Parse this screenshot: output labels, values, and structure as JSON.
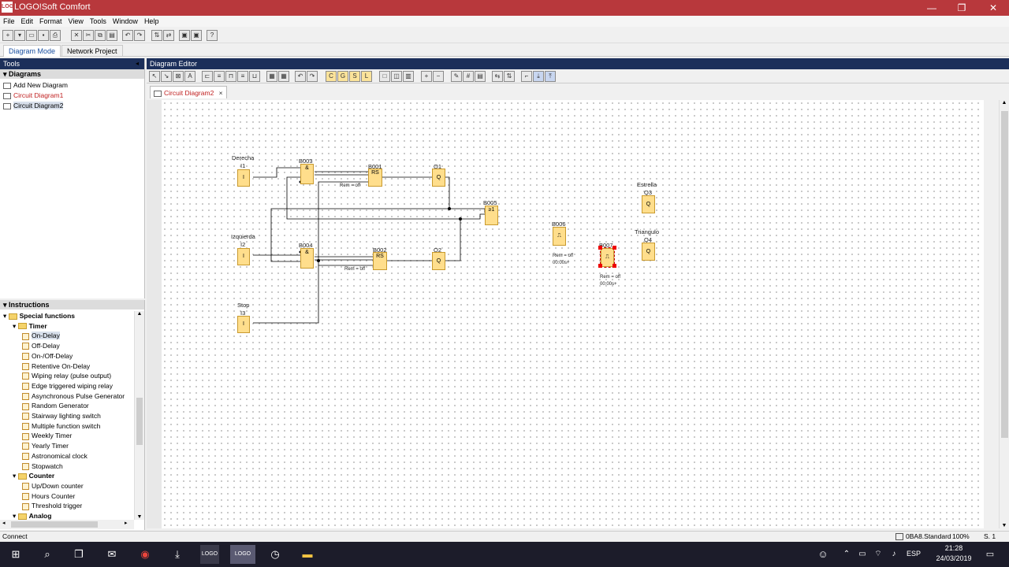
{
  "window": {
    "title": "LOGO!Soft Comfort",
    "app_icon": "LOGO!",
    "minimize": "—",
    "maximize": "❐",
    "close": "✕"
  },
  "menu": [
    "File",
    "Edit",
    "Format",
    "View",
    "Tools",
    "Window",
    "Help"
  ],
  "mode_tabs": {
    "diagram": "Diagram Mode",
    "network": "Network Project"
  },
  "tools_panel": {
    "title": "Tools",
    "diagrams_header": "Diagrams",
    "items": [
      "Add New Diagram",
      "Circuit Diagram1",
      "Circuit Diagram2"
    ]
  },
  "instructions": {
    "title": "Instructions",
    "tree": [
      {
        "label": "Special functions",
        "level": 0,
        "type": "folder",
        "bold": true
      },
      {
        "label": "Timer",
        "level": 1,
        "type": "folder",
        "bold": true
      },
      {
        "label": "On-Delay",
        "level": 2,
        "type": "leaf",
        "selected": true
      },
      {
        "label": "Off-Delay",
        "level": 2,
        "type": "leaf"
      },
      {
        "label": "On-/Off-Delay",
        "level": 2,
        "type": "leaf"
      },
      {
        "label": "Retentive On-Delay",
        "level": 2,
        "type": "leaf"
      },
      {
        "label": "Wiping relay (pulse output)",
        "level": 2,
        "type": "leaf"
      },
      {
        "label": "Edge triggered wiping relay",
        "level": 2,
        "type": "leaf"
      },
      {
        "label": "Asynchronous Pulse Generator",
        "level": 2,
        "type": "leaf"
      },
      {
        "label": "Random Generator",
        "level": 2,
        "type": "leaf"
      },
      {
        "label": "Stairway lighting switch",
        "level": 2,
        "type": "leaf"
      },
      {
        "label": "Multiple function switch",
        "level": 2,
        "type": "leaf"
      },
      {
        "label": "Weekly Timer",
        "level": 2,
        "type": "leaf"
      },
      {
        "label": "Yearly Timer",
        "level": 2,
        "type": "leaf"
      },
      {
        "label": "Astronomical clock",
        "level": 2,
        "type": "leaf"
      },
      {
        "label": "Stopwatch",
        "level": 2,
        "type": "leaf"
      },
      {
        "label": "Counter",
        "level": 1,
        "type": "folder",
        "bold": true
      },
      {
        "label": "Up/Down counter",
        "level": 2,
        "type": "leaf"
      },
      {
        "label": "Hours Counter",
        "level": 2,
        "type": "leaf"
      },
      {
        "label": "Threshold trigger",
        "level": 2,
        "type": "leaf"
      },
      {
        "label": "Analog",
        "level": 1,
        "type": "folder",
        "bold": true
      }
    ]
  },
  "editor": {
    "title": "Diagram Editor",
    "tab": "Circuit Diagram2",
    "tab_close": "×"
  },
  "diagram": {
    "labels": {
      "i1_name": "Derecha",
      "i1": "I1",
      "i2_name": "Izquierda",
      "i2": "I2",
      "i3_name": "Stop",
      "i3": "I3",
      "b003": "B003",
      "b004": "B004",
      "b001": "B001",
      "b002": "B002",
      "q1": "Q1",
      "q2": "Q2",
      "b005": "B005",
      "b006": "B006",
      "b007": "B007",
      "q3_name": "Estrella",
      "q3": "Q3",
      "q4_name": "Triangulo",
      "q4": "Q4",
      "rem1": "Rem = off",
      "rem2": "Rem = off",
      "rem6": "Rem = off",
      "time6": "00:00s+",
      "rem7": "Rem = off",
      "time7": "00:00s+"
    },
    "symbols": {
      "input": "I",
      "and": "&",
      "rs": "RS",
      "output": "Q",
      "or": "≥1",
      "timer": "⎍"
    }
  },
  "status": {
    "left": "Connect",
    "device": "0BA8.Standard",
    "zoom": "100%",
    "page": "S. 1"
  },
  "taskbar": {
    "time": "21:28",
    "date": "24/03/2019",
    "lang": "ESP"
  }
}
